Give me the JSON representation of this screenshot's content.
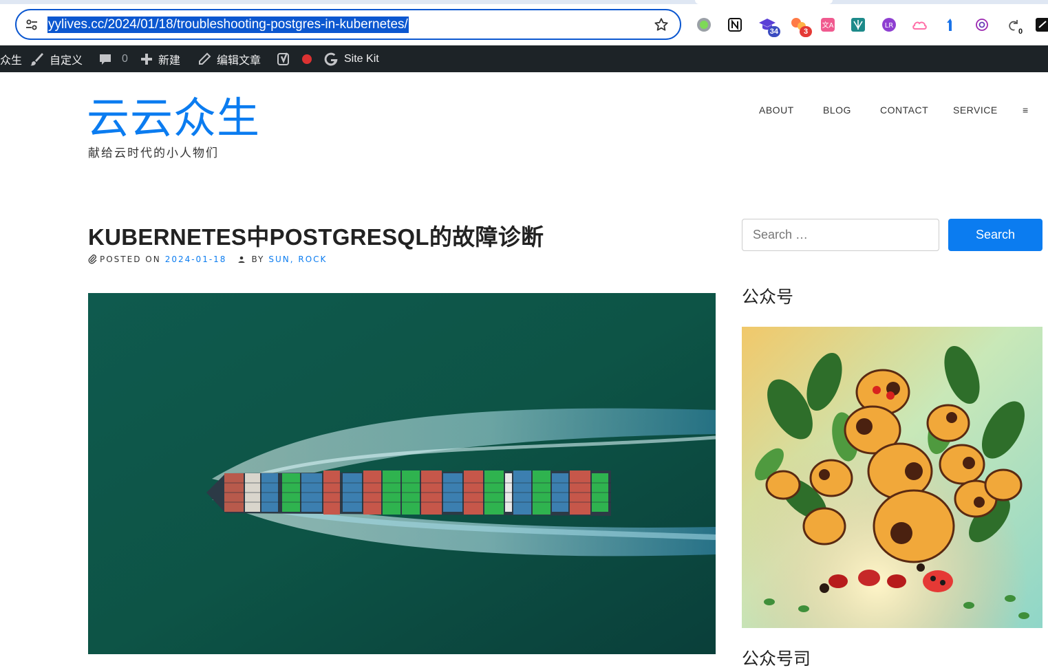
{
  "browser": {
    "url": "yylives.cc/2024/01/18/troubleshooting-postgres-in-kubernetes/",
    "icons": {
      "site_info": "tune-icon",
      "bookmark": "star-icon"
    },
    "extensions": [
      {
        "name": "green-circle-extension-icon",
        "badge": ""
      },
      {
        "name": "notion-extension-icon",
        "badge": ""
      },
      {
        "name": "graduation-cap-extension-icon",
        "badge": "34"
      },
      {
        "name": "orange-bubbles-extension-icon",
        "badge": "3"
      },
      {
        "name": "translate-extension-icon",
        "badge": ""
      },
      {
        "name": "teal-logo-extension-icon",
        "badge": ""
      },
      {
        "name": "purple-logo-extension-icon",
        "badge": ""
      },
      {
        "name": "pink-cloud-extension-icon",
        "badge": ""
      },
      {
        "name": "blue-arrow-extension-icon",
        "badge": ""
      },
      {
        "name": "openai-extension-icon",
        "badge": ""
      },
      {
        "name": "refresh-counter-extension-icon",
        "badge": "0"
      },
      {
        "name": "dark-extension-icon",
        "badge": ""
      }
    ]
  },
  "adminbar": {
    "site_fragment": "众生",
    "customize": "自定义",
    "comments_count": "0",
    "new": "新建",
    "edit_post": "编辑文章",
    "sitekit": "Site Kit"
  },
  "site": {
    "title": "云云众生",
    "description": "献给云时代的小人物们"
  },
  "nav": {
    "items": [
      "ABOUT",
      "BLOG",
      "CONTACT",
      "SERVICE"
    ],
    "menu_toggle": "≡"
  },
  "post": {
    "title": "KUBERNETES中POSTGRESQL的故障诊断",
    "posted_on_label": "POSTED ON",
    "date": "2024-01-18",
    "by_label": "BY",
    "author": "SUN, ROCK"
  },
  "sidebar": {
    "search": {
      "placeholder": "Search …",
      "button_label": "Search"
    },
    "widget_title": "公众号",
    "next_widget_title_fragment": "公众号司"
  },
  "colors": {
    "accent": "#0b7cf0",
    "admin_bar": "#1d2327",
    "omnibox_focus": "#0b57d0"
  }
}
